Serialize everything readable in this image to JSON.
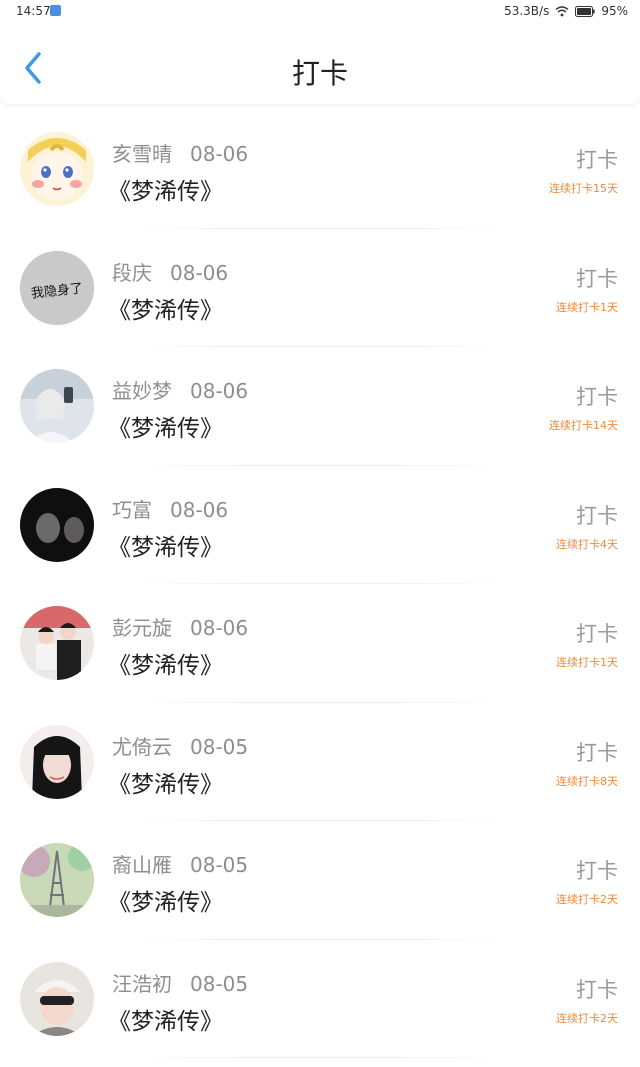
{
  "status_bar": {
    "time": "14:57",
    "speed": "53.3B/s",
    "battery": "95%"
  },
  "header": {
    "title": "打卡"
  },
  "entries": [
    {
      "name": "亥雪晴",
      "date": "08-06",
      "book": "《梦浠传》",
      "action": "打卡",
      "streak": "连续打卡15天"
    },
    {
      "name": "段庆",
      "date": "08-06",
      "book": "《梦浠传》",
      "action": "打卡",
      "streak": "连续打卡1天",
      "avatar_text": "我隐身了"
    },
    {
      "name": "益妙梦",
      "date": "08-06",
      "book": "《梦浠传》",
      "action": "打卡",
      "streak": "连续打卡14天"
    },
    {
      "name": "巧富",
      "date": "08-06",
      "book": "《梦浠传》",
      "action": "打卡",
      "streak": "连续打卡4天"
    },
    {
      "name": "彭元旋",
      "date": "08-06",
      "book": "《梦浠传》",
      "action": "打卡",
      "streak": "连续打卡1天"
    },
    {
      "name": "尤倚云",
      "date": "08-05",
      "book": "《梦浠传》",
      "action": "打卡",
      "streak": "连续打卡8天"
    },
    {
      "name": "裔山雁",
      "date": "08-05",
      "book": "《梦浠传》",
      "action": "打卡",
      "streak": "连续打卡2天"
    },
    {
      "name": "汪浩初",
      "date": "08-05",
      "book": "《梦浠传》",
      "action": "打卡",
      "streak": "连续打卡2天"
    }
  ],
  "colors": {
    "accent_back": "#3a9ae8",
    "streak": "#f08a3a",
    "muted": "#8e8e8e"
  }
}
